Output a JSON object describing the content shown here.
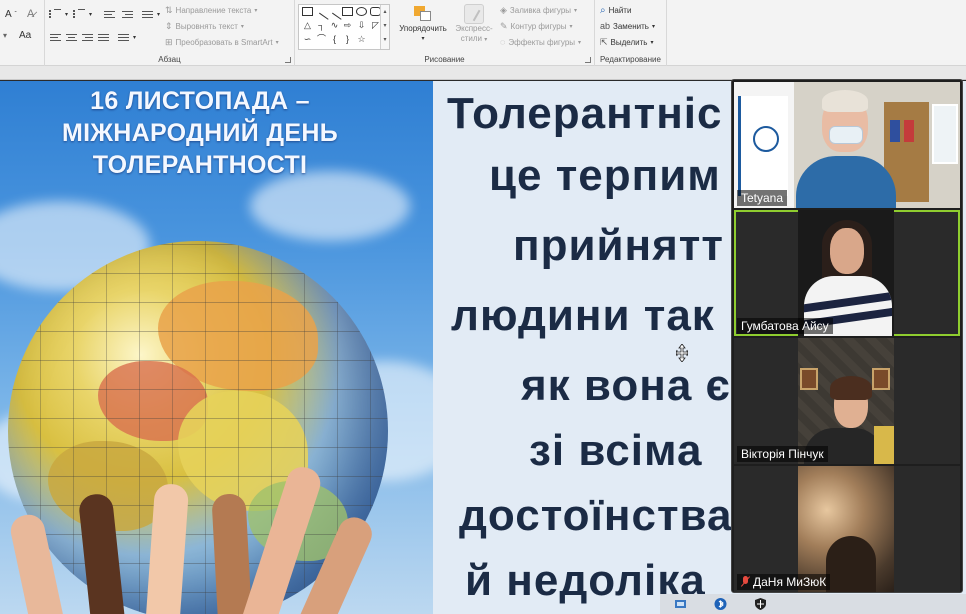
{
  "ribbon": {
    "paragraph_group": {
      "title": "Абзац",
      "text_direction": "Направление текста",
      "align_text": "Выровнять текст",
      "convert_smartart": "Преобразовать в SmartArt"
    },
    "drawing_group": {
      "title": "Рисование",
      "arrange": "Упорядочить",
      "quick_styles_line1": "Экспресс-",
      "quick_styles_line2": "стили",
      "shape_fill": "Заливка фигуры",
      "shape_outline": "Контур фигуры",
      "shape_effects": "Эффекты фигуры"
    },
    "editing_group": {
      "title": "Редактирование",
      "find": "Найти",
      "replace": "Заменить",
      "select": "Выделить"
    }
  },
  "slide": {
    "left_title": [
      "16 ЛИСТОПАДА –",
      "МІЖНАРОДНИЙ ДЕНЬ",
      "ТОЛЕРАНТНОСТІ"
    ],
    "right_text": [
      "Толерантніс",
      "це терпим",
      "прийнятт",
      "людини так",
      "як вона є",
      "зі всіма",
      "достоїнства",
      "й недоліка"
    ]
  },
  "participants": [
    {
      "name": "Tetyana",
      "active": false,
      "muted": false
    },
    {
      "name": "Гумбатова Айсу",
      "active": true,
      "muted": false
    },
    {
      "name": "Вікторія Пінчук",
      "active": false,
      "muted": false
    },
    {
      "name": "ДаНя МиЗюК",
      "active": false,
      "muted": true
    }
  ],
  "colors": {
    "active_speaker": "#8fcd2f",
    "muted_icon": "#e84a3f",
    "slide_text": "#1b2b45"
  }
}
